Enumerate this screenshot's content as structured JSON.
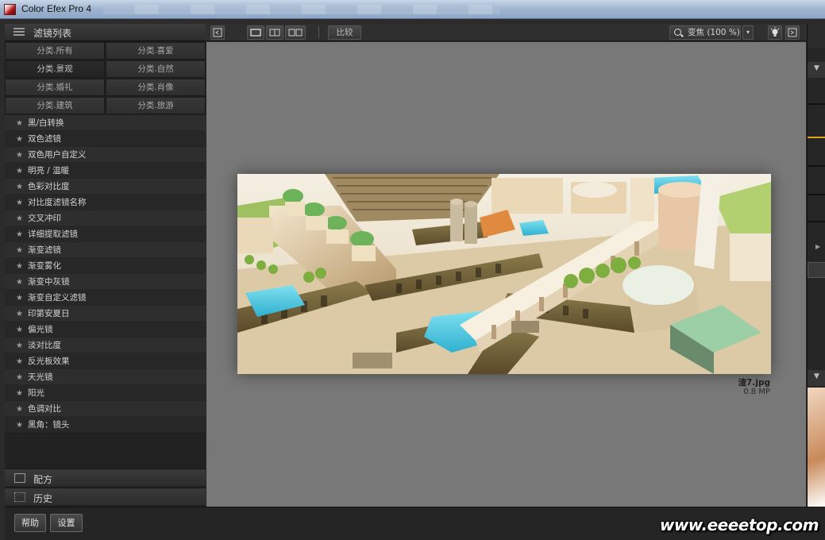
{
  "window": {
    "title": "Color Efex Pro 4"
  },
  "left_panel": {
    "header": "滤镜列表",
    "categories": [
      {
        "label": "分类.所有"
      },
      {
        "label": "分类.喜爱"
      },
      {
        "label": "分类.景观"
      },
      {
        "label": "分类.自然"
      },
      {
        "label": "分类.婚礼"
      },
      {
        "label": "分类.肖像"
      },
      {
        "label": "分类.建筑"
      },
      {
        "label": "分类.旅游"
      }
    ],
    "filters": [
      "黑/白转换",
      "双色滤镜",
      "双色用户自定义",
      "明亮 / 温暖",
      "色彩对比度",
      "对比度滤镜名称",
      "交叉冲印",
      "详细提取滤镜",
      "渐变滤镜",
      "渐变雾化",
      "渐变中灰镜",
      "渐变自定义滤镜",
      "印第安夏日",
      "偏光镜",
      "淡对比度",
      "反光板效果",
      "天光镜",
      "阳光",
      "色调对比",
      "黑角：镜头"
    ],
    "recipes_label": "配方",
    "history_label": "历史"
  },
  "toolbar": {
    "compare_label": "比较",
    "zoom_label": "变焦 (100 %)"
  },
  "image": {
    "filename": "渣7.jpg",
    "size": "0.8 MP"
  },
  "bottom": {
    "help_label": "帮助",
    "settings_label": "设置",
    "watermark": "www.eeeetop.com"
  },
  "colors": {
    "panel_bg": "#222222",
    "canvas_bg": "#787878",
    "accent_line": "#e0a020"
  }
}
